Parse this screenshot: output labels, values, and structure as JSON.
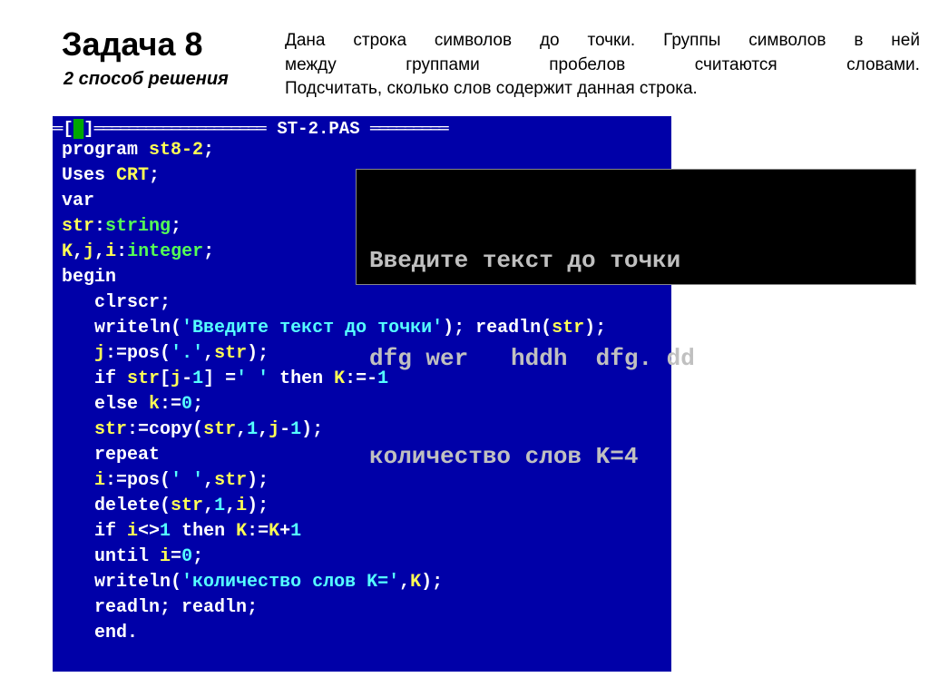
{
  "header": {
    "title": "Задача 8",
    "subtitle": "2 способ решения"
  },
  "description": {
    "line1_words": [
      "Дана",
      "строка",
      "символов",
      "до",
      "точки.",
      "Группы",
      "символов",
      "в",
      "ней"
    ],
    "line2_words": [
      "между",
      "группами",
      "пробелов",
      "считаются",
      "словами."
    ],
    "line3": "Подсчитать, сколько слов содержит данная строка."
  },
  "code": {
    "filename": "ST-2.PAS",
    "lines": [
      [
        [
          "kw",
          "program "
        ],
        [
          "ident",
          "st8-2"
        ],
        [
          "op",
          ";"
        ]
      ],
      [
        [
          "kw",
          "Uses "
        ],
        [
          "ident",
          "CRT"
        ],
        [
          "op",
          ";"
        ]
      ],
      [
        [
          "kw",
          "var"
        ]
      ],
      [
        [
          "ident",
          "str"
        ],
        [
          "op",
          ":"
        ],
        [
          "typ",
          "string"
        ],
        [
          "op",
          ";"
        ]
      ],
      [
        [
          "ident",
          "K"
        ],
        [
          "op",
          ","
        ],
        [
          "ident",
          "j"
        ],
        [
          "op",
          ","
        ],
        [
          "ident",
          "i"
        ],
        [
          "op",
          ":"
        ],
        [
          "typ",
          "integer"
        ],
        [
          "op",
          ";"
        ]
      ],
      [
        [
          "kw",
          "begin"
        ]
      ],
      [
        [
          "kw",
          "   clrscr"
        ],
        [
          "op",
          ";"
        ]
      ],
      [
        [
          "kw",
          "   writeln"
        ],
        [
          "op",
          "("
        ],
        [
          "str",
          "'Введите текст до точки'"
        ],
        [
          "op",
          "); "
        ],
        [
          "kw",
          "readln"
        ],
        [
          "op",
          "("
        ],
        [
          "ident",
          "str"
        ],
        [
          "op",
          ");"
        ]
      ],
      [
        [
          "ident",
          "   j"
        ],
        [
          "op",
          ":="
        ],
        [
          "kw",
          "pos"
        ],
        [
          "op",
          "("
        ],
        [
          "str",
          "'.'"
        ],
        [
          "op",
          ","
        ],
        [
          "ident",
          "str"
        ],
        [
          "op",
          ");"
        ]
      ],
      [
        [
          "kw",
          "   if "
        ],
        [
          "ident",
          "str"
        ],
        [
          "op",
          "["
        ],
        [
          "ident",
          "j"
        ],
        [
          "op",
          "-"
        ],
        [
          "num",
          "1"
        ],
        [
          "op",
          "] ="
        ],
        [
          "str",
          "' '"
        ],
        [
          "kw",
          " then "
        ],
        [
          "ident",
          "K"
        ],
        [
          "op",
          ":=-"
        ],
        [
          "num",
          "1"
        ]
      ],
      [
        [
          "kw",
          "   else "
        ],
        [
          "ident",
          "k"
        ],
        [
          "op",
          ":="
        ],
        [
          "num",
          "0"
        ],
        [
          "op",
          ";"
        ]
      ],
      [
        [
          "ident",
          "   str"
        ],
        [
          "op",
          ":="
        ],
        [
          "kw",
          "copy"
        ],
        [
          "op",
          "("
        ],
        [
          "ident",
          "str"
        ],
        [
          "op",
          ","
        ],
        [
          "num",
          "1"
        ],
        [
          "op",
          ","
        ],
        [
          "ident",
          "j"
        ],
        [
          "op",
          "-"
        ],
        [
          "num",
          "1"
        ],
        [
          "op",
          ");"
        ]
      ],
      [
        [
          "kw",
          "   repeat"
        ]
      ],
      [
        [
          "ident",
          "   i"
        ],
        [
          "op",
          ":="
        ],
        [
          "kw",
          "pos"
        ],
        [
          "op",
          "("
        ],
        [
          "str",
          "' '"
        ],
        [
          "op",
          ","
        ],
        [
          "ident",
          "str"
        ],
        [
          "op",
          ");"
        ]
      ],
      [
        [
          "kw",
          "   delete"
        ],
        [
          "op",
          "("
        ],
        [
          "ident",
          "str"
        ],
        [
          "op",
          ","
        ],
        [
          "num",
          "1"
        ],
        [
          "op",
          ","
        ],
        [
          "ident",
          "i"
        ],
        [
          "op",
          ");"
        ]
      ],
      [
        [
          "kw",
          "   if "
        ],
        [
          "ident",
          "i"
        ],
        [
          "op",
          "<>"
        ],
        [
          "num",
          "1"
        ],
        [
          "kw",
          " then "
        ],
        [
          "ident",
          "K"
        ],
        [
          "op",
          ":="
        ],
        [
          "ident",
          "K"
        ],
        [
          "op",
          "+"
        ],
        [
          "num",
          "1"
        ]
      ],
      [
        [
          "kw",
          "   until "
        ],
        [
          "ident",
          "i"
        ],
        [
          "op",
          "="
        ],
        [
          "num",
          "0"
        ],
        [
          "op",
          ";"
        ]
      ],
      [
        [
          "kw",
          "   writeln"
        ],
        [
          "op",
          "("
        ],
        [
          "str",
          "'количество слов K='"
        ],
        [
          "op",
          ","
        ],
        [
          "ident",
          "K"
        ],
        [
          "op",
          ");"
        ]
      ],
      [
        [
          "kw",
          "   readln"
        ],
        [
          "op",
          "; "
        ],
        [
          "kw",
          "readln"
        ],
        [
          "op",
          ";"
        ]
      ],
      [
        [
          "kw",
          "   end"
        ],
        [
          "op",
          "."
        ]
      ]
    ]
  },
  "output": {
    "line1": "Введите текст до точки",
    "line2": "dfg wer   hddh  dfg. dd",
    "line3": "количество слов K=4"
  }
}
